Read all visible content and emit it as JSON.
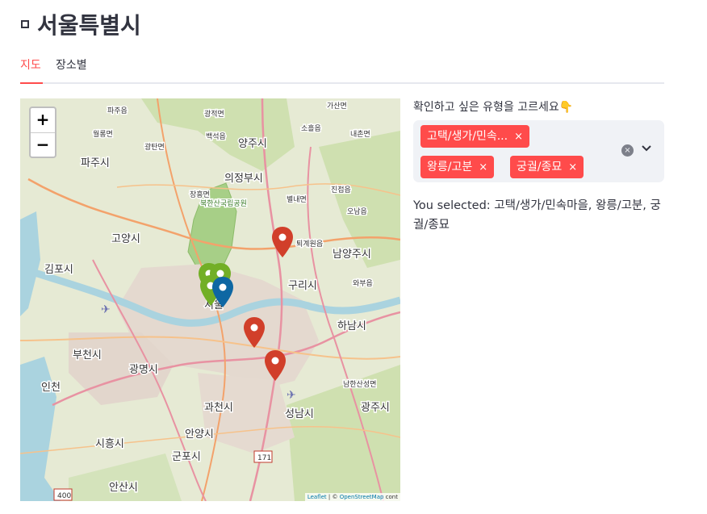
{
  "title": "서울특별시",
  "tabs": [
    {
      "label": "지도"
    },
    {
      "label": "장소별"
    }
  ],
  "map": {
    "zoom_in": "+",
    "zoom_out": "−",
    "attribution_leaflet": "Leaflet",
    "attribution_sep": " | © ",
    "attribution_osm": "OpenStreetMap",
    "attribution_rest": " cont",
    "place_labels": {
      "paju": "파주시",
      "gimpo": "김포시",
      "goyang": "고양시",
      "yangju": "양주시",
      "uijeongbu": "의정부시",
      "namyangju": "남양주시",
      "guri": "구리시",
      "seoul": "서울",
      "bucheon": "부천시",
      "gwangmyeong": "광명시",
      "incheon": "인천",
      "hanam": "하남시",
      "gwacheon": "과천시",
      "seongnam": "성남시",
      "gwangju": "광주시",
      "anyang": "안양시",
      "siheung": "시흥시",
      "gunpo": "군포시",
      "ansan": "안산시",
      "bukhansan": "북한산국립공원",
      "gwangjeok": "광적면",
      "baekseok": "백석읍",
      "gwangtan": "광탄면",
      "wollong": "월롱면",
      "paju_eup": "파주읍",
      "gaseong": "가산면",
      "soheul": "소흘읍",
      "naechon": "내촌면",
      "jingeon": "진접읍",
      "byeollae": "별내면",
      "onam": "오남읍",
      "toegyewon": "퇴계원읍",
      "wabu": "와부읍",
      "jangheung": "장흥면",
      "namhansanseong": "남한산성면",
      "road_171": "171",
      "road_400": "400"
    }
  },
  "multiselect": {
    "label": "확인하고 싶은 유형을 고르세요👇",
    "tags": [
      "고택/생가/민속...",
      "왕릉/고분",
      "궁궐/종묘"
    ],
    "tag_remove": "×",
    "clear_icon": "×",
    "chevron": "⌄"
  },
  "selected_text": "You selected: 고택/생가/민속마을, 왕릉/고분, 궁궐/종묘",
  "colors": {
    "accent": "#ff4b4b",
    "marker_red": "#d13f2a",
    "marker_green": "#72af26",
    "marker_blue": "#0e67a3"
  }
}
